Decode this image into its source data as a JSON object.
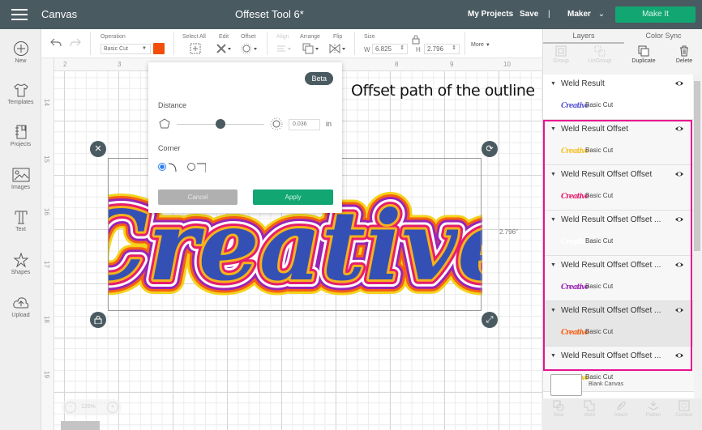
{
  "topbar": {
    "app_title": "Canvas",
    "doc_title": "Offeset Tool 6*",
    "my_projects": "My Projects",
    "save": "Save",
    "divider": "|",
    "machine": "Maker",
    "make_it": "Make It"
  },
  "sidebar": {
    "items": [
      {
        "label": "New",
        "icon": "plus-circle-icon"
      },
      {
        "label": "Templates",
        "icon": "shirt-icon"
      },
      {
        "label": "Projects",
        "icon": "notebook-icon"
      },
      {
        "label": "Images",
        "icon": "image-icon"
      },
      {
        "label": "Text",
        "icon": "text-icon"
      },
      {
        "label": "Shapes",
        "icon": "shapes-icon"
      },
      {
        "label": "Upload",
        "icon": "cloud-upload-icon"
      }
    ]
  },
  "toolbar": {
    "operation_label": "Operation",
    "operation_value": "Basic Cut",
    "operation_color": "#f24e0a",
    "select_all": "Select All",
    "edit": "Edit",
    "offset": "Offset",
    "align": "Align",
    "arrange": "Arrange",
    "flip": "Flip",
    "size": "Size",
    "w_label": "W",
    "w_value": "6.825",
    "h_label": "H",
    "h_value": "2.796",
    "more": "More"
  },
  "rulers": {
    "top": [
      "2",
      "3",
      "8",
      "9",
      "10"
    ],
    "left": [
      "14",
      "15",
      "16",
      "17",
      "18",
      "19"
    ]
  },
  "canvas": {
    "annotation": "Offset path of the outline",
    "artwork_text": "Creative",
    "height_readout": "2.796\"",
    "zoom_level": "125%"
  },
  "offset_popup": {
    "badge": "Beta",
    "distance_label": "Distance",
    "distance_value": "0.036",
    "distance_unit": "in",
    "distance_fraction": 0.5,
    "corner_label": "Corner",
    "corner_selected": "rounded",
    "cancel": "Cancel",
    "apply": "Apply"
  },
  "panel": {
    "tabs": [
      "Layers",
      "Color Sync"
    ],
    "tools": [
      "Group",
      "UnGroup",
      "Duplicate",
      "Delete"
    ],
    "layers": [
      {
        "title": "Weld Result",
        "sub": "Basic Cut",
        "thumb": "Creative",
        "color": "#5b5bd6"
      },
      {
        "title": "Weld Result Offset",
        "sub": "Basic Cut",
        "thumb": "Creative",
        "color": "#f6c12a"
      },
      {
        "title": "Weld Result Offset Offset",
        "sub": "Basic Cut",
        "thumb": "Creative",
        "color": "#e61e6e"
      },
      {
        "title": "Weld Result Offset Offset ...",
        "sub": "Basic Cut",
        "thumb": "Creative",
        "color": "#ffffff"
      },
      {
        "title": "Weld Result Offset Offset ...",
        "sub": "Basic Cut",
        "thumb": "Creative",
        "color": "#9b23b5"
      },
      {
        "title": "Weld Result Offset Offset ...",
        "sub": "Basic Cut",
        "thumb": "Creative",
        "color": "#f85f12"
      },
      {
        "title": "Weld Result Offset Offset ...",
        "sub": "Basic Cut",
        "thumb": "Creative",
        "color": "#e8c21a"
      }
    ],
    "blank_canvas": "Blank Canvas",
    "bottom_tools": [
      "Slice",
      "Weld",
      "Attach",
      "Flatten",
      "Contour"
    ]
  },
  "colors": {
    "topbar": "#4a5a61",
    "accent_green": "#12a672",
    "highlight": "#e8118f"
  }
}
